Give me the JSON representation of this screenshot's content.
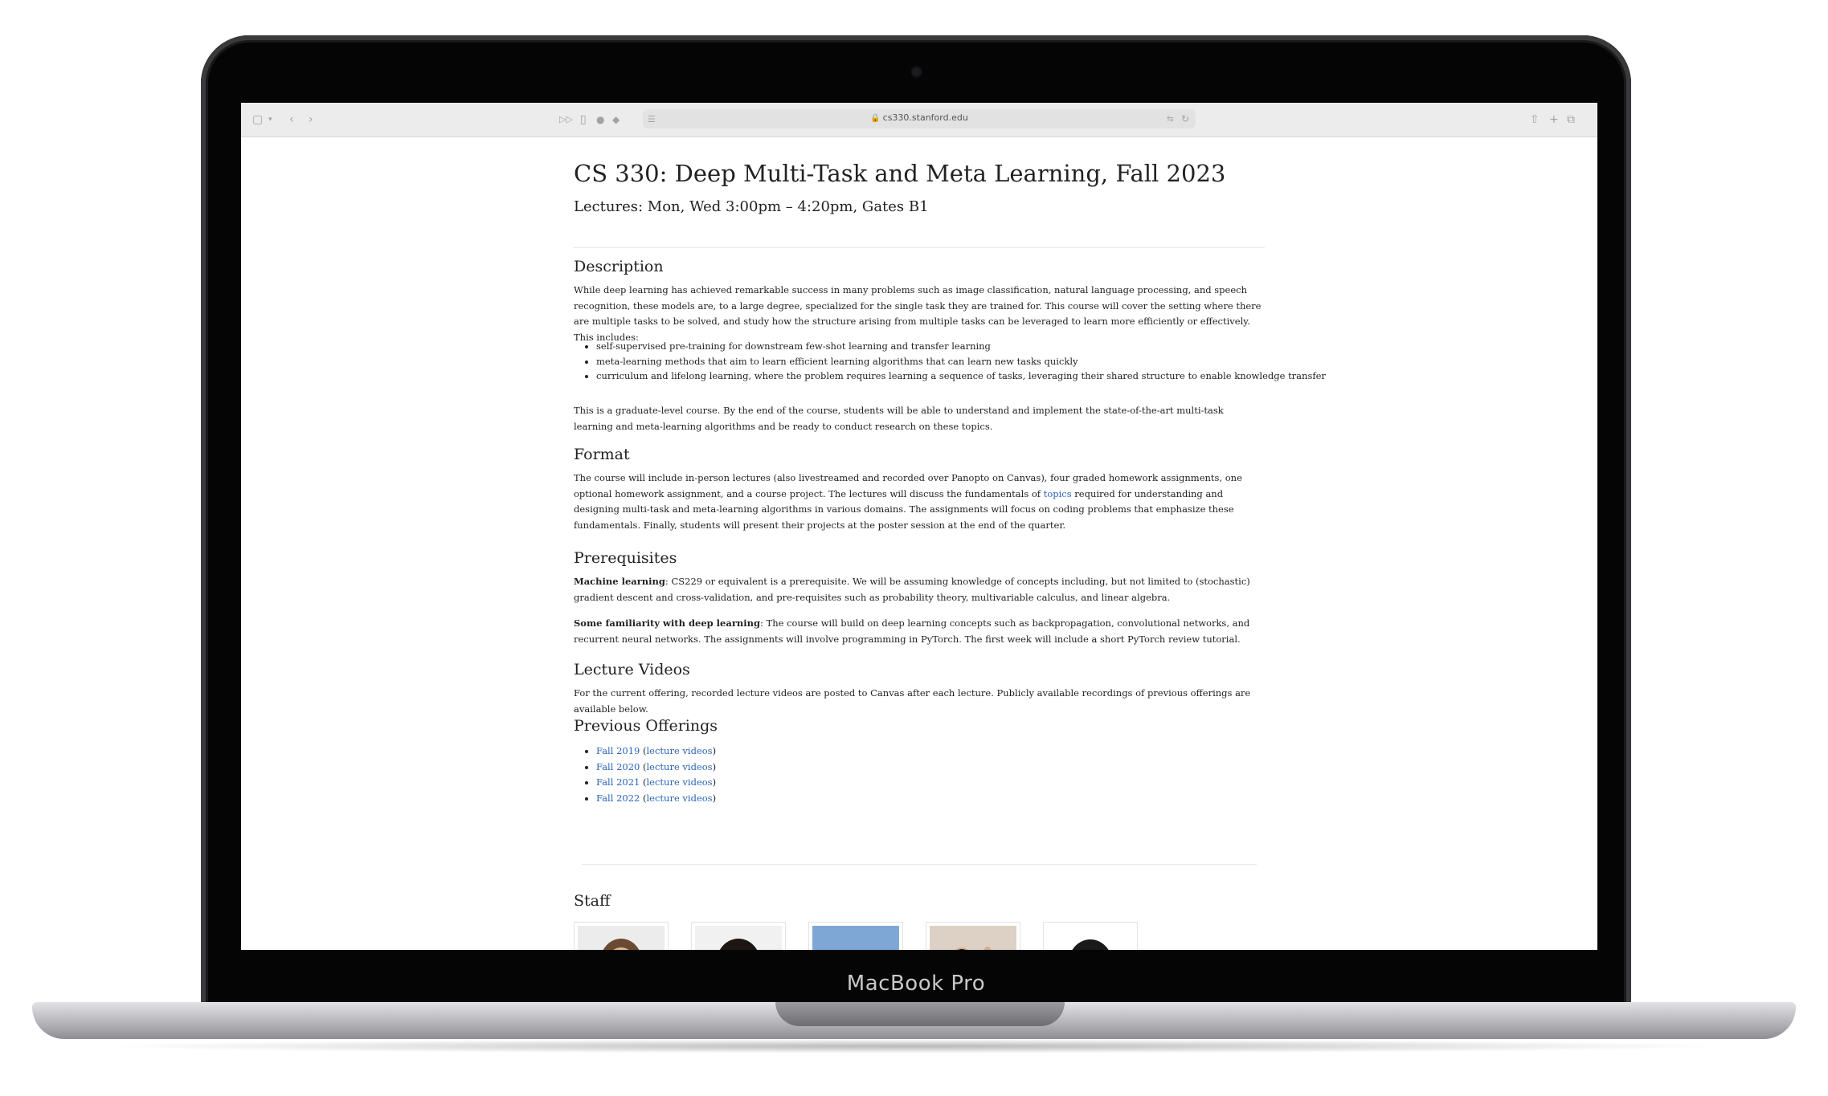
{
  "device": {
    "label": "MacBook Pro"
  },
  "browser": {
    "url": "cs330.stanford.edu",
    "toolbar_icons": [
      "sidebar-icon",
      "chevron-down-icon",
      "back-icon",
      "forward-icon",
      "reader-icon",
      "page-icon",
      "privacy-icon",
      "extension-icon",
      "list-icon",
      "translate-icon",
      "reload-icon",
      "share-icon",
      "new-tab-icon",
      "tabs-icon"
    ]
  },
  "page": {
    "title": "CS 330: Deep Multi-Task and Meta Learning, Fall 2023",
    "subtitle": "Lectures: Mon, Wed 3:00pm – 4:20pm, Gates B1",
    "description": {
      "heading": "Description",
      "intro": "While deep learning has achieved remarkable success in many problems such as image classification, natural language processing, and speech recognition, these models are, to a large degree, specialized for the single task they are trained for. This course will cover the setting where there are multiple tasks to be solved, and study how the structure arising from multiple tasks can be leveraged to learn more efficiently or effectively. This includes:",
      "bullets": [
        "self-supervised pre-training for downstream few-shot learning and transfer learning",
        "meta-learning methods that aim to learn efficient learning algorithms that can learn new tasks quickly",
        "curriculum and lifelong learning, where the problem requires learning a sequence of tasks, leveraging their shared structure to enable knowledge transfer"
      ],
      "outro": "This is a graduate-level course. By the end of the course, students will be able to understand and implement the state-of-the-art multi-task learning and meta-learning algorithms and be ready to conduct research on these topics."
    },
    "format": {
      "heading": "Format",
      "text_before_link": "The course will include in-person lectures (also livestreamed and recorded over Panopto on Canvas), four graded homework assignments, one optional homework assignment, and a course project. The lectures will discuss the fundamentals of ",
      "link": "topics",
      "text_after_link": " required for understanding and designing multi-task and meta-learning algorithms in various domains. The assignments will focus on coding problems that emphasize these fundamentals. Finally, students will present their projects at the poster session at the end of the quarter."
    },
    "prerequisites": {
      "heading": "Prerequisites",
      "ml_label": "Machine learning",
      "ml_text": ": CS229 or equivalent is a prerequisite. We will be assuming knowledge of concepts including, but not limited to (stochastic) gradient descent and cross-validation, and pre-requisites such as probability theory, multivariable calculus, and linear algebra.",
      "dl_label": "Some familiarity with deep learning",
      "dl_text": ": The course will build on deep learning concepts such as backpropagation, convolutional networks, and recurrent neural networks. The assignments will involve programming in PyTorch. The first week will include a short PyTorch review tutorial."
    },
    "lecture_videos": {
      "heading": "Lecture Videos",
      "text": "For the current offering, recorded lecture videos are posted to Canvas after each lecture. Publicly available recordings of previous offerings are available below."
    },
    "previous_offerings": {
      "heading": "Previous Offerings",
      "items": [
        {
          "term": "Fall 2019",
          "videos": "lecture videos"
        },
        {
          "term": "Fall 2020",
          "videos": "lecture videos"
        },
        {
          "term": "Fall 2021",
          "videos": "lecture videos"
        },
        {
          "term": "Fall 2022",
          "videos": "lecture videos"
        }
      ]
    },
    "staff": {
      "heading": "Staff",
      "photo_count": 5
    }
  }
}
